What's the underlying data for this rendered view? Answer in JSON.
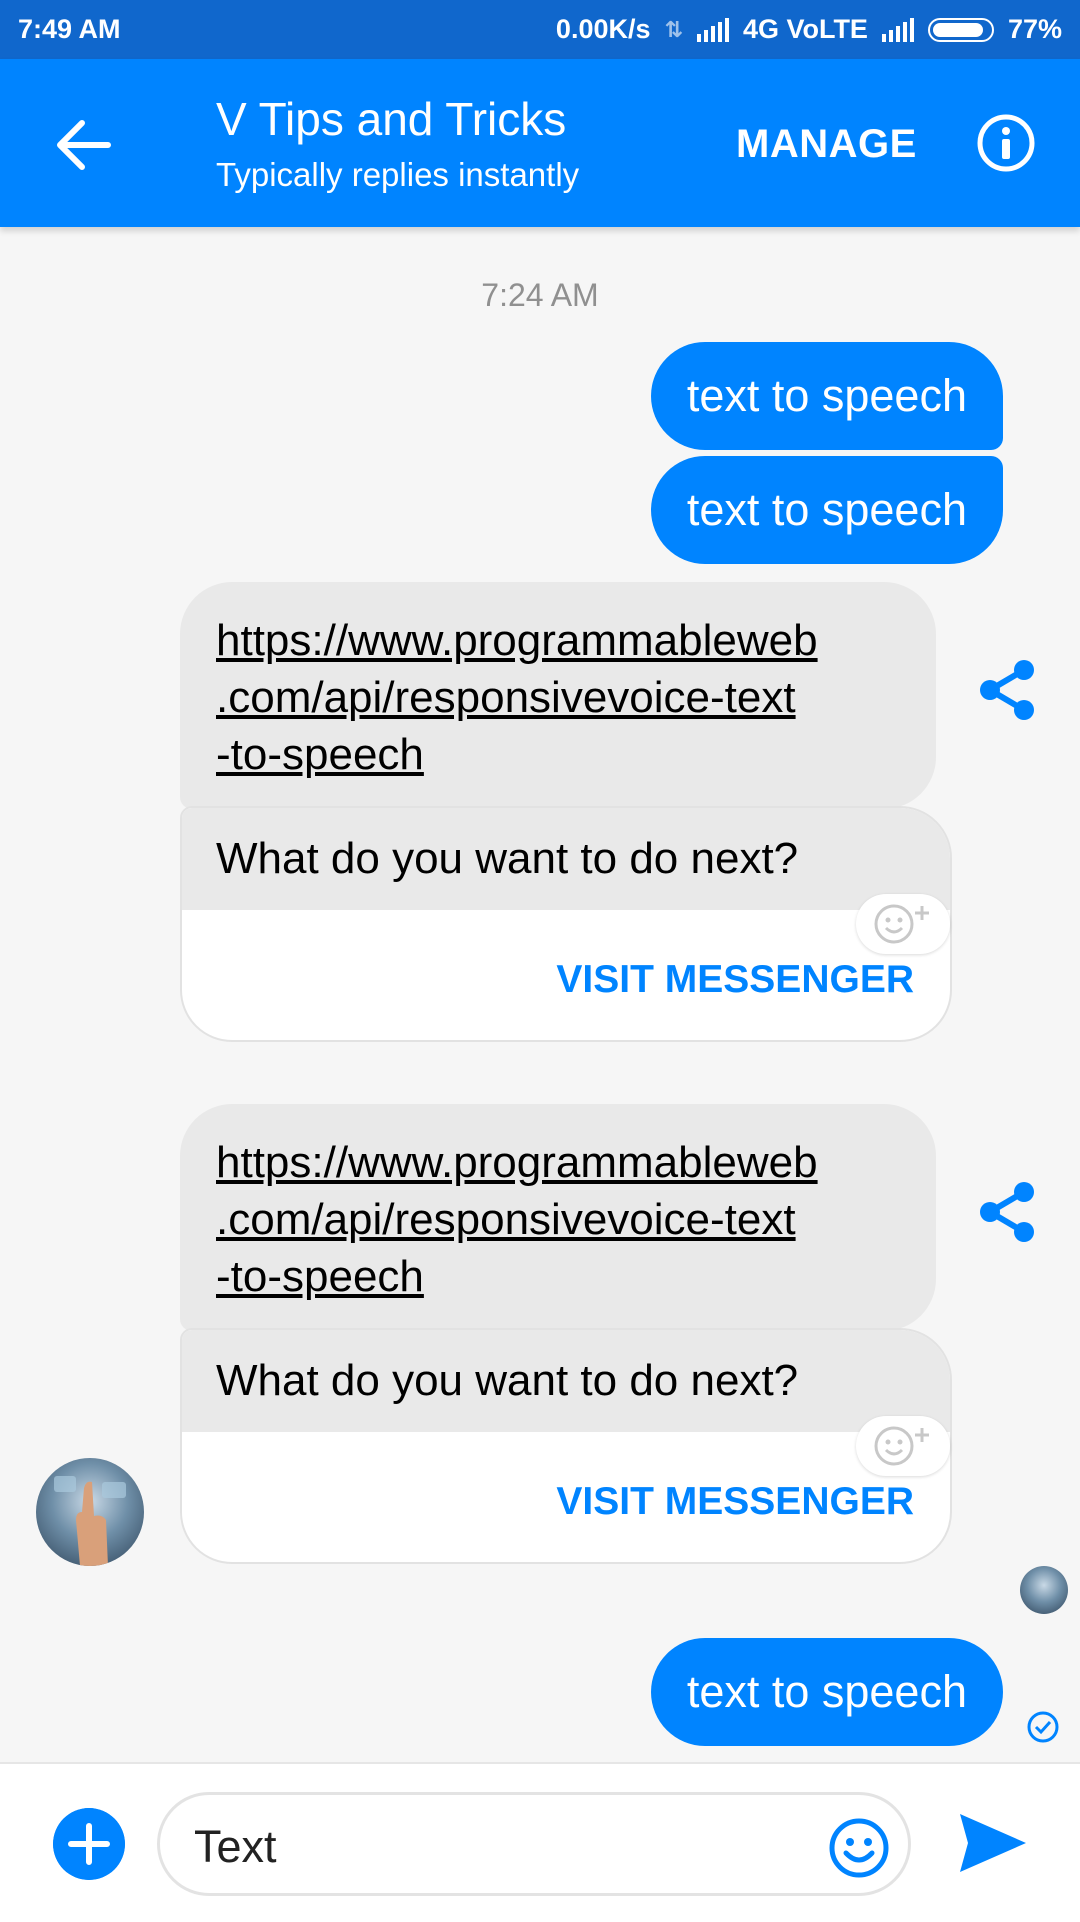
{
  "status_bar": {
    "time": "7:49 AM",
    "network_speed": "0.00K/s",
    "network_type": "4G VoLTE",
    "battery": "77%"
  },
  "header": {
    "title": "V Tips and Tricks",
    "subtitle": "Typically replies instantly",
    "manage_label": "MANAGE",
    "back_icon": "arrow-left-icon",
    "info_icon": "info-icon"
  },
  "chat": {
    "timestamp": "7:24 AM",
    "outgoing_1": "text to speech",
    "outgoing_2": "text to speech",
    "link_1": "https://www.programmableweb.com/api/responsivevoice-text-to-speech",
    "link_1_lines": [
      "https://www.programmableweb",
      ".com/api/responsivevoice-text",
      "-to-speech"
    ],
    "card_1": {
      "question": "What do you want to do next?",
      "action": "VISIT MESSENGER"
    },
    "link_2_lines": [
      "https://www.programmableweb",
      ".com/api/responsivevoice-text",
      "-to-speech"
    ],
    "card_2": {
      "question": "What do you want to do next?",
      "action": "VISIT MESSENGER"
    },
    "outgoing_3": "text to speech"
  },
  "composer": {
    "value": "Text",
    "plus_icon": "plus-circle-icon",
    "emoji_icon": "smiley-icon",
    "send_icon": "send-icon"
  },
  "colors": {
    "accent": "#0084ff",
    "status_bar": "#1067cc",
    "incoming_bubble": "#e9e9e9"
  }
}
